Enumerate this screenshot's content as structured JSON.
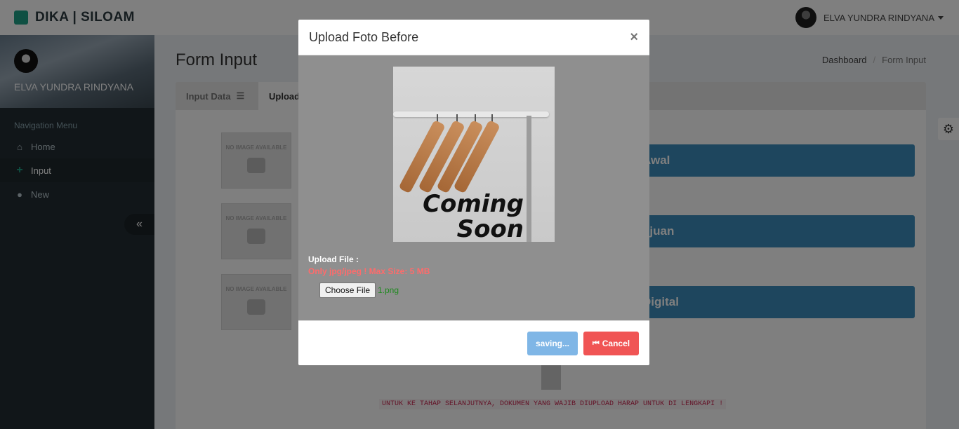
{
  "header": {
    "brand": "DIKA | SILOAM",
    "user_name": "ELVA YUNDRA RINDYANA"
  },
  "sidebar": {
    "user_name": "ELVA YUNDRA RINDYANA",
    "nav_header": "Navigation Menu",
    "items": [
      {
        "label": "Home",
        "icon": "home-icon"
      },
      {
        "label": "Input",
        "icon": "plus-icon",
        "active": true
      },
      {
        "label": "New",
        "icon": "user-icon"
      }
    ],
    "collapse_glyph": "«"
  },
  "content": {
    "title": "Form Input",
    "breadcrumb": [
      "Dashboard",
      "Form Input"
    ],
    "tabs": [
      {
        "label": "Input Data",
        "icon": "database-icon"
      },
      {
        "label": "Upload",
        "active": true
      }
    ],
    "no_image_text": "NO IMAGE AVAILABLE",
    "buttons": [
      "Awal",
      "ujuan",
      "Digital"
    ],
    "warning": "UNTUK KE TAHAP SELANJUTNYA, DOKUMEN YANG WAJIB DIUPLOAD HARAP UNTUK DI LENGKAPI !"
  },
  "modal": {
    "title": "Upload Foto Before",
    "close": "×",
    "preview_text_1": "Coming",
    "preview_text_2": "Soon",
    "upload_label": "Upload File :",
    "upload_hint": "Only jpg/jpeg ! Max Size: 5 MB",
    "choose_file": "Choose File",
    "file_name": "1.png",
    "save_label": "saving...",
    "cancel_label": "Cancel"
  },
  "colors": {
    "primary": "#3c8dbc",
    "danger": "#f05454",
    "success_text": "#1e8a1e",
    "sidebar": "#222d32"
  }
}
